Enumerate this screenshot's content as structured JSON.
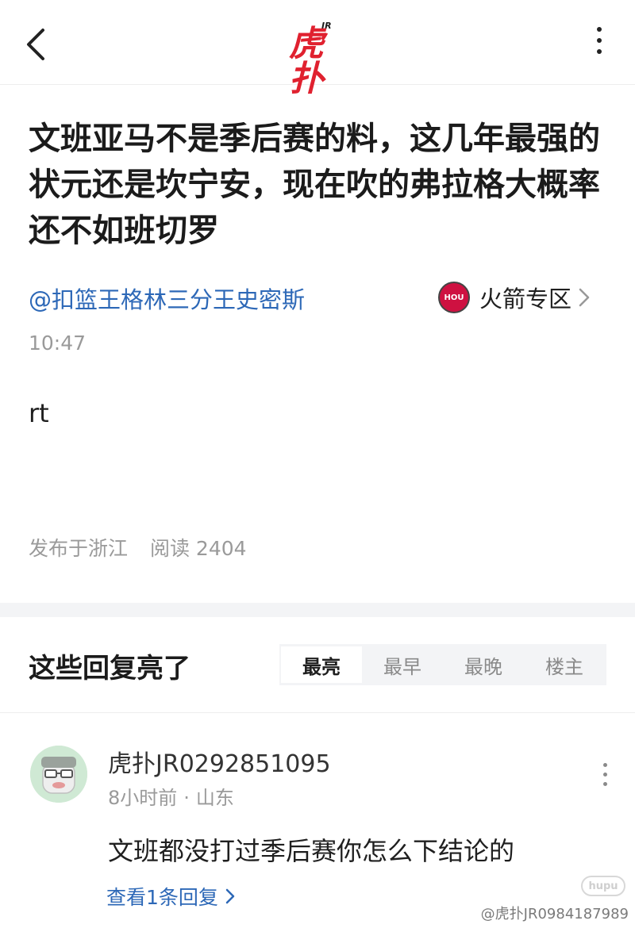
{
  "header": {
    "back_icon": "chevron-left-icon",
    "logo_small": "JR",
    "logo_text": "虎扑",
    "more_icon": "vertical-ellipsis-icon"
  },
  "post": {
    "title": "文班亚马不是季后赛的料，这几年最强的状元还是坎宁安，现在吹的弗拉格大概率还不如班切罗",
    "author": "@扣篮王格林三分王史密斯",
    "zone": {
      "logo_text": "HOU",
      "label": "火箭专区",
      "accent": "#ce1141"
    },
    "time": "10:47",
    "body": "rt",
    "location": "发布于浙江",
    "reads": "阅读 2404"
  },
  "replies_section": {
    "heading": "这些回复亮了",
    "tabs": [
      "最亮",
      "最早",
      "最晚",
      "楼主"
    ],
    "active_tab": "最亮"
  },
  "reply": {
    "username": "虎扑JR0292851095",
    "time_ago": "8小时前",
    "separator": "·",
    "location": "山东",
    "text": "文班都没打过季后赛你怎么下结论的",
    "view_replies": "查看1条回复"
  },
  "watermark": {
    "logo": "hupu",
    "text": "@虎扑JR0984187989"
  },
  "colors": {
    "link_blue": "#2d68b7",
    "brand_red": "#e0212f",
    "muted_gray": "#9a9a9a"
  }
}
